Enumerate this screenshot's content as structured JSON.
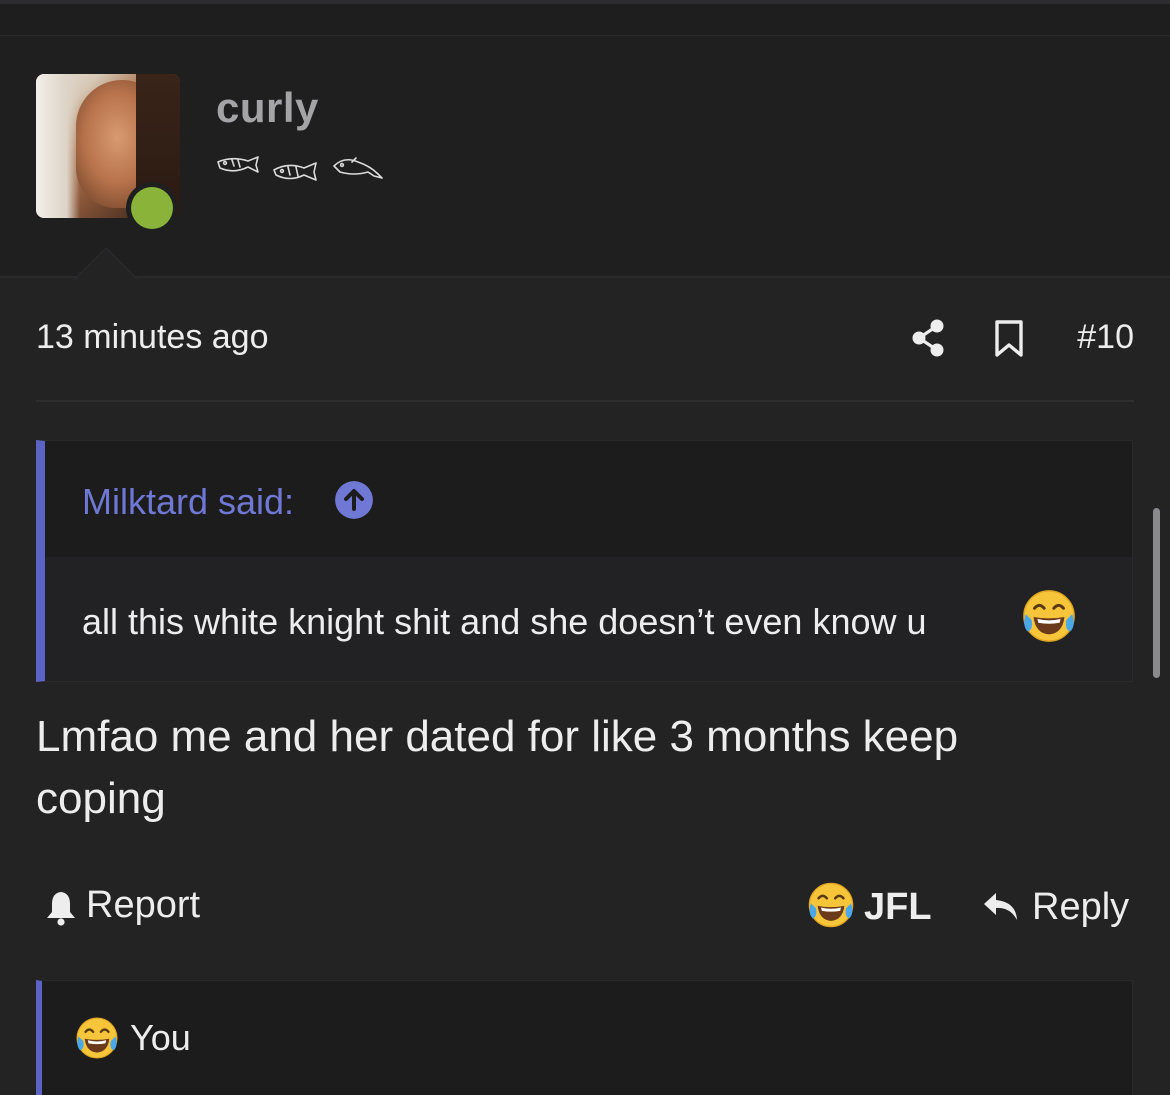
{
  "user": {
    "name": "curly",
    "status": "online",
    "badge_icons": [
      "fish-icon",
      "fish-icon",
      "fish-icon"
    ]
  },
  "post": {
    "timestamp": "13 minutes ago",
    "number": "#10",
    "body": "Lmfao me and her dated for like 3 months keep coping"
  },
  "quote": {
    "author_label": "Milktard said:",
    "text": "all this white knight shit and she doesn’t even know u",
    "emoji": "joy-emoji"
  },
  "actions": {
    "report_label": "Report",
    "reaction_label": "JFL",
    "reply_label": "Reply"
  },
  "reactions": {
    "summary_label": "You",
    "emoji": "joy-emoji"
  },
  "colors": {
    "background": "#232324",
    "accent": "#5b63c4",
    "link": "#6f78d4",
    "online": "#8ab33a"
  }
}
